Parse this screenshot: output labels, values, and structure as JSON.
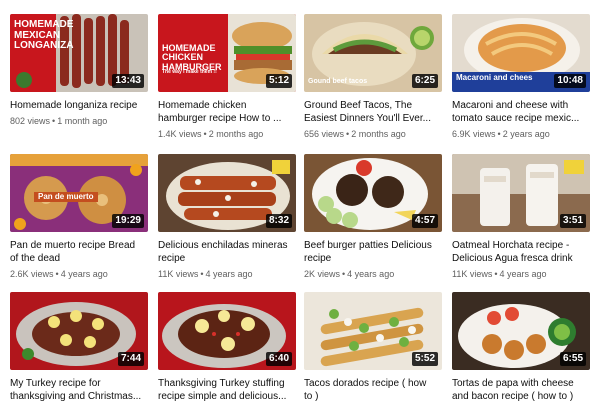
{
  "videos": [
    {
      "title": "Homemade longaniza recipe",
      "views": "802 views",
      "age": "1 month ago",
      "duration": "13:43",
      "overlay": "HOMEMADE MEXICAN LONGANIZA"
    },
    {
      "title": "Homemade chicken hamburger recipe How to ...",
      "views": "1.4K views",
      "age": "2 months ago",
      "duration": "5:12",
      "overlay": "HOMEMADE CHICKEN HAMBURGER",
      "overlay_sub": "The way I make them !!"
    },
    {
      "title": "Ground Beef Tacos, The Easiest Dinners You'll Ever...",
      "views": "656 views",
      "age": "2 months ago",
      "duration": "6:25",
      "overlay": "Gound beef tacos"
    },
    {
      "title": "Macaroni and cheese with tomato sauce recipe mexic...",
      "views": "6.9K views",
      "age": "2 years ago",
      "duration": "10:48",
      "overlay": "Macaroni and chees"
    },
    {
      "title": "Pan de muerto recipe Bread of the dead",
      "views": "2.6K views",
      "age": "4 years ago",
      "duration": "19:29",
      "overlay": "Pan de muerto"
    },
    {
      "title": "Delicious enchiladas mineras recipe",
      "views": "11K views",
      "age": "4 years ago",
      "duration": "8:32",
      "overlay": ""
    },
    {
      "title": "Beef burger patties Delicious recipe",
      "views": "2K views",
      "age": "4 years ago",
      "duration": "4:57",
      "overlay": ""
    },
    {
      "title": "Oatmeal Horchata recipe - Delicious Agua fresca drink",
      "views": "11K views",
      "age": "4 years ago",
      "duration": "3:51",
      "overlay": ""
    },
    {
      "title": "My Turkey recipe for thanksgiving and Christmas...",
      "views": "",
      "age": "",
      "duration": "7:44",
      "overlay": ""
    },
    {
      "title": "Thanksgiving Turkey stuffing recipe simple and delicious...",
      "views": "",
      "age": "",
      "duration": "6:40",
      "overlay": ""
    },
    {
      "title": "Tacos dorados recipe ( how to )",
      "views": "",
      "age": "",
      "duration": "5:52",
      "overlay": ""
    },
    {
      "title": "Tortas de papa with cheese and bacon recipe ( how to )",
      "views": "",
      "age": "",
      "duration": "6:55",
      "overlay": ""
    }
  ],
  "colors": {
    "title": "#0f0f0f",
    "meta": "#606060",
    "duration_bg": "#000000cc"
  }
}
